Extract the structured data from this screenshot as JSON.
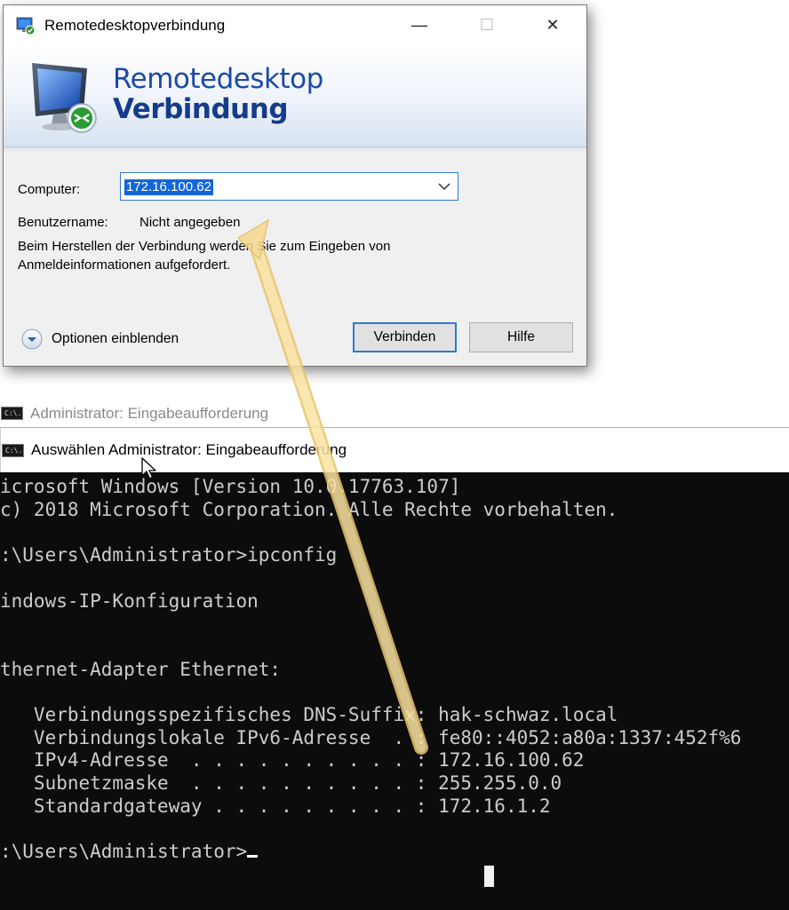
{
  "rdp_dialog": {
    "window_title": "Remotedesktopverbindung",
    "controls": {
      "minimize": "—",
      "maximize": "☐",
      "close": "✕"
    },
    "brand_line1": "Remotedesktop",
    "brand_line2": "Verbindung",
    "computer_label": "Computer:",
    "computer_value": "172.16.100.62",
    "username_label": "Benutzername:",
    "username_value": "Nicht angegeben",
    "info_text": "Beim Herstellen der Verbindung werden Sie zum Eingeben von Anmeldeinformationen aufgefordert.",
    "options_label": "Optionen einblenden",
    "connect_button": "Verbinden",
    "help_button": "Hilfe"
  },
  "console_back": {
    "icon_text": "C:\\.",
    "title": "Administrator: Eingabeaufforderung"
  },
  "console_front": {
    "icon_text": "C:\\.",
    "title": "Auswählen Administrator: Eingabeaufforderung",
    "lines": [
      "icrosoft Windows [Version 10.0.17763.107]",
      "c) 2018 Microsoft Corporation. Alle Rechte vorbehalten.",
      "",
      ":\\Users\\Administrator>ipconfig",
      "",
      "indows-IP-Konfiguration",
      "",
      "",
      "thernet-Adapter Ethernet:",
      "",
      "   Verbindungsspezifisches DNS-Suffix: hak-schwaz.local",
      "   Verbindungslokale IPv6-Adresse  . : fe80::4052:a80a:1337:452f%6",
      "   IPv4-Adresse  . . . . . . . . . . : 172.16.100.62",
      "   Subnetzmaske  . . . . . . . . . . : 255.255.0.0",
      "   Standardgateway . . . . . . . . . : 172.16.1.2",
      "",
      ":\\Users\\Administrator>"
    ]
  },
  "colors": {
    "console_bg": "#0c0c0c",
    "console_text": "#cccccc",
    "selection": "#1466d6",
    "brand_blue": "#1d4aa6",
    "arrow": "#f7d98c"
  },
  "icons": [
    "rdp-app-icon",
    "monitor-icon",
    "chevron-down-icon",
    "options-expand-icon",
    "cmd-icon",
    "mouse-pointer-icon",
    "annotation-arrow"
  ]
}
